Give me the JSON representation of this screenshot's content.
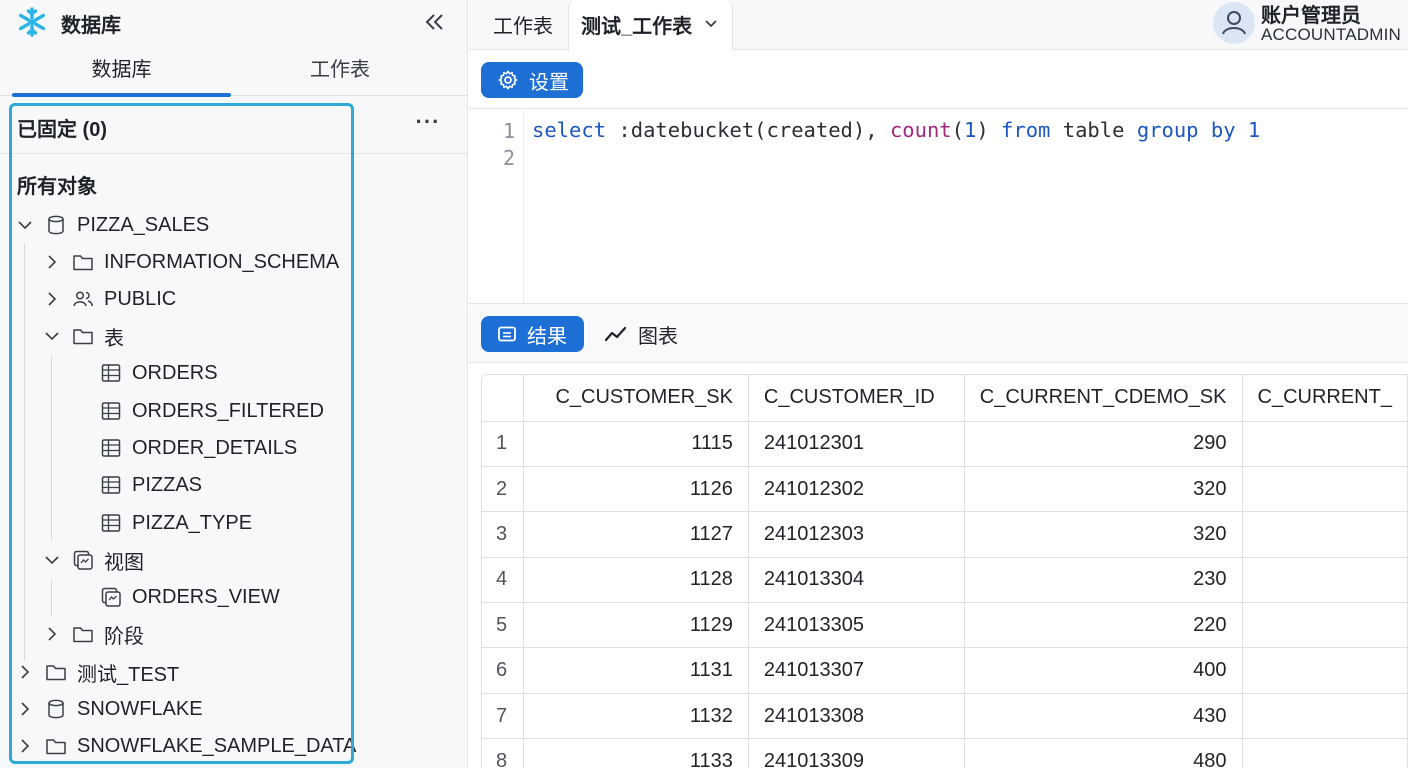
{
  "sidebar": {
    "title": "数据库",
    "tabs": {
      "databases": "数据库",
      "worksheets": "工作表"
    },
    "pinned_label": "已固定 (0)",
    "pinned_more": "···",
    "all_objects_label": "所有对象",
    "tree": [
      {
        "label": "PIZZA_SALES",
        "icon": "database-icon",
        "expanded": true
      },
      {
        "label": "INFORMATION_SCHEMA",
        "icon": "folder-icon",
        "expanded": false
      },
      {
        "label": "PUBLIC",
        "icon": "users-icon",
        "expanded": false
      },
      {
        "label": "表",
        "icon": "folder-icon",
        "expanded": true
      },
      {
        "label": "ORDERS",
        "icon": "table-icon"
      },
      {
        "label": "ORDERS_FILTERED",
        "icon": "table-icon"
      },
      {
        "label": "ORDER_DETAILS",
        "icon": "table-icon"
      },
      {
        "label": "PIZZAS",
        "icon": "table-icon"
      },
      {
        "label": "PIZZA_TYPE",
        "icon": "table-icon"
      },
      {
        "label": "视图",
        "icon": "view-icon",
        "expanded": true
      },
      {
        "label": "ORDERS_VIEW",
        "icon": "view-icon"
      },
      {
        "label": "阶段",
        "icon": "folder-icon",
        "expanded": false
      },
      {
        "label": "测试_TEST",
        "icon": "folder-icon",
        "expanded": false
      },
      {
        "label": "SNOWFLAKE",
        "icon": "database-icon",
        "expanded": false
      },
      {
        "label": "SNOWFLAKE_SAMPLE_DATA",
        "icon": "folder-icon",
        "expanded": false
      }
    ]
  },
  "topbar": {
    "worksheets_tab": "工作表",
    "active_tab": "测试_工作表",
    "account_name": "账户管理员",
    "account_role": "ACCOUNTADMIN"
  },
  "toolbar": {
    "settings_label": "设置"
  },
  "editor": {
    "line_numbers": [
      "1",
      "2"
    ],
    "tokens": {
      "select": "select",
      "arg": " :datebucket(created), ",
      "count": "count",
      "open": "(",
      "one": "1",
      "close": ") ",
      "from": "from",
      "table": " table ",
      "group_by": "group by",
      "space": " ",
      "last": "1"
    }
  },
  "results_bar": {
    "results_label": "结果",
    "chart_label": "图表"
  },
  "results": {
    "columns": [
      "C_CUSTOMER_SK",
      "C_CUSTOMER_ID",
      "C_CURRENT_CDEMO_SK",
      "C_CURRENT_"
    ],
    "rows": [
      [
        "1",
        "1115",
        "241012301",
        "290",
        ""
      ],
      [
        "2",
        "1126",
        "241012302",
        "320",
        ""
      ],
      [
        "3",
        "1127",
        "241012303",
        "320",
        ""
      ],
      [
        "4",
        "1128",
        "241013304",
        "230",
        ""
      ],
      [
        "5",
        "1129",
        "241013305",
        "220",
        ""
      ],
      [
        "6",
        "1131",
        "241013307",
        "400",
        ""
      ],
      [
        "7",
        "1132",
        "241013308",
        "430",
        ""
      ],
      [
        "8",
        "1133",
        "241013309",
        "480",
        ""
      ]
    ]
  },
  "colors": {
    "accent": "#1d6fd6",
    "highlight": "#2eaad7",
    "keyword": "#1c57c2",
    "function": "#a3287d"
  }
}
